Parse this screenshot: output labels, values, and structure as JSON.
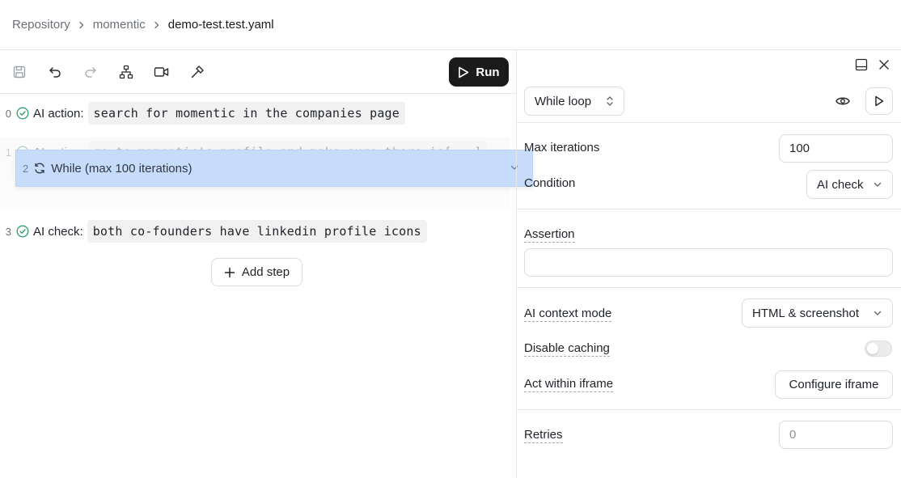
{
  "breadcrumb": {
    "items": [
      "Repository",
      "momentic",
      "demo-test.test.yaml"
    ]
  },
  "toolbar": {
    "icons": [
      "save-icon",
      "undo-icon",
      "redo-icon",
      "hierarchy-icon",
      "video-icon",
      "hammer-icon"
    ],
    "run_label": "Run"
  },
  "steps": [
    {
      "index": "0",
      "kind": "AI action:",
      "text": "search for momentic in the companies page"
    },
    {
      "index": "1",
      "kind": "AI action:",
      "text": "go to momentic's profile and make sure there is[...]"
    },
    {
      "index": "3",
      "kind": "AI check:",
      "text": "both co-founders have linkedin profile icons"
    }
  ],
  "dragging": {
    "index": "2",
    "label": "While (max 100 iterations)"
  },
  "add_step_label": "Add step",
  "panel": {
    "step_type": "While loop",
    "max_iterations": {
      "label": "Max iterations",
      "value": "100"
    },
    "condition": {
      "label": "Condition",
      "value": "AI check"
    },
    "assertion": {
      "label": "Assertion",
      "value": ""
    },
    "context_mode": {
      "label": "AI context mode",
      "value": "HTML & screenshot"
    },
    "disable_caching": {
      "label": "Disable caching",
      "enabled": false
    },
    "iframe": {
      "label": "Act within iframe",
      "button": "Configure iframe"
    },
    "retries": {
      "label": "Retries",
      "placeholder": "0"
    }
  },
  "colors": {
    "accent_check": "#2f9e6e",
    "drag_highlight": "#c7dcfb",
    "run_bg": "#1b1b1b"
  }
}
